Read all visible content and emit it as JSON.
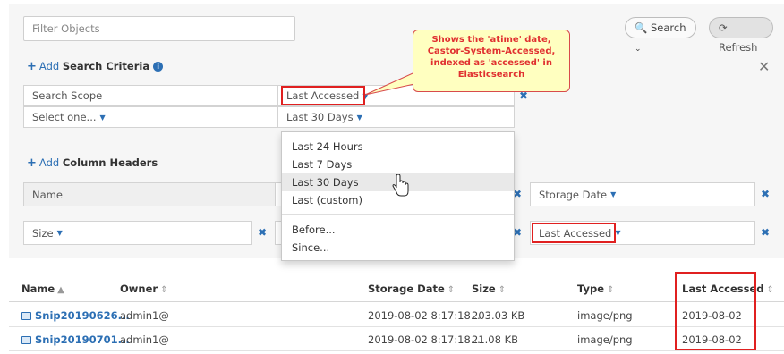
{
  "filter": {
    "placeholder": "Filter Objects"
  },
  "toolbar": {
    "search_label": "Search",
    "refresh_label": "Refresh"
  },
  "criteria": {
    "add_word": "Add",
    "title": "Search Criteria",
    "scope_label": "Search Scope",
    "scope_value": "Select one...",
    "field_label": "Last Accessed",
    "field_value": "Last 30 Days"
  },
  "callout": {
    "line1": "Shows the 'atime' date,",
    "line2": "Castor-System-Accessed,",
    "line3": "indexed as 'accessed' in",
    "line4": "Elasticsearch"
  },
  "dropdown": {
    "items": [
      "Last 24 Hours",
      "Last 7 Days",
      "Last 30 Days",
      "Last (custom)",
      "Before...",
      "Since..."
    ],
    "hovered_index": 2
  },
  "columns_section": {
    "add_word": "Add",
    "title": "Column Headers",
    "name_label": "Name",
    "size_label": "Size",
    "storage_label": "Storage Date",
    "accessed_label": "Last Accessed"
  },
  "table": {
    "headers": [
      "Name",
      "Owner",
      "Storage Date",
      "Size",
      "Type",
      "Last Accessed"
    ],
    "rows": [
      {
        "name": "Snip20190626...",
        "owner": "admin1@",
        "storage_date": "2019-08-02 8:17:18...",
        "size": "203.03 KB",
        "type": "image/png",
        "accessed": "2019-08-02"
      },
      {
        "name": "Snip20190701...",
        "owner": "admin1@",
        "storage_date": "2019-08-02 8:17:18...",
        "size": "21.08 KB",
        "type": "image/png",
        "accessed": "2019-08-02"
      }
    ]
  },
  "colors": {
    "accent": "#2c6fb4",
    "highlight": "#e02020",
    "callout_bg": "#ffffc0"
  }
}
